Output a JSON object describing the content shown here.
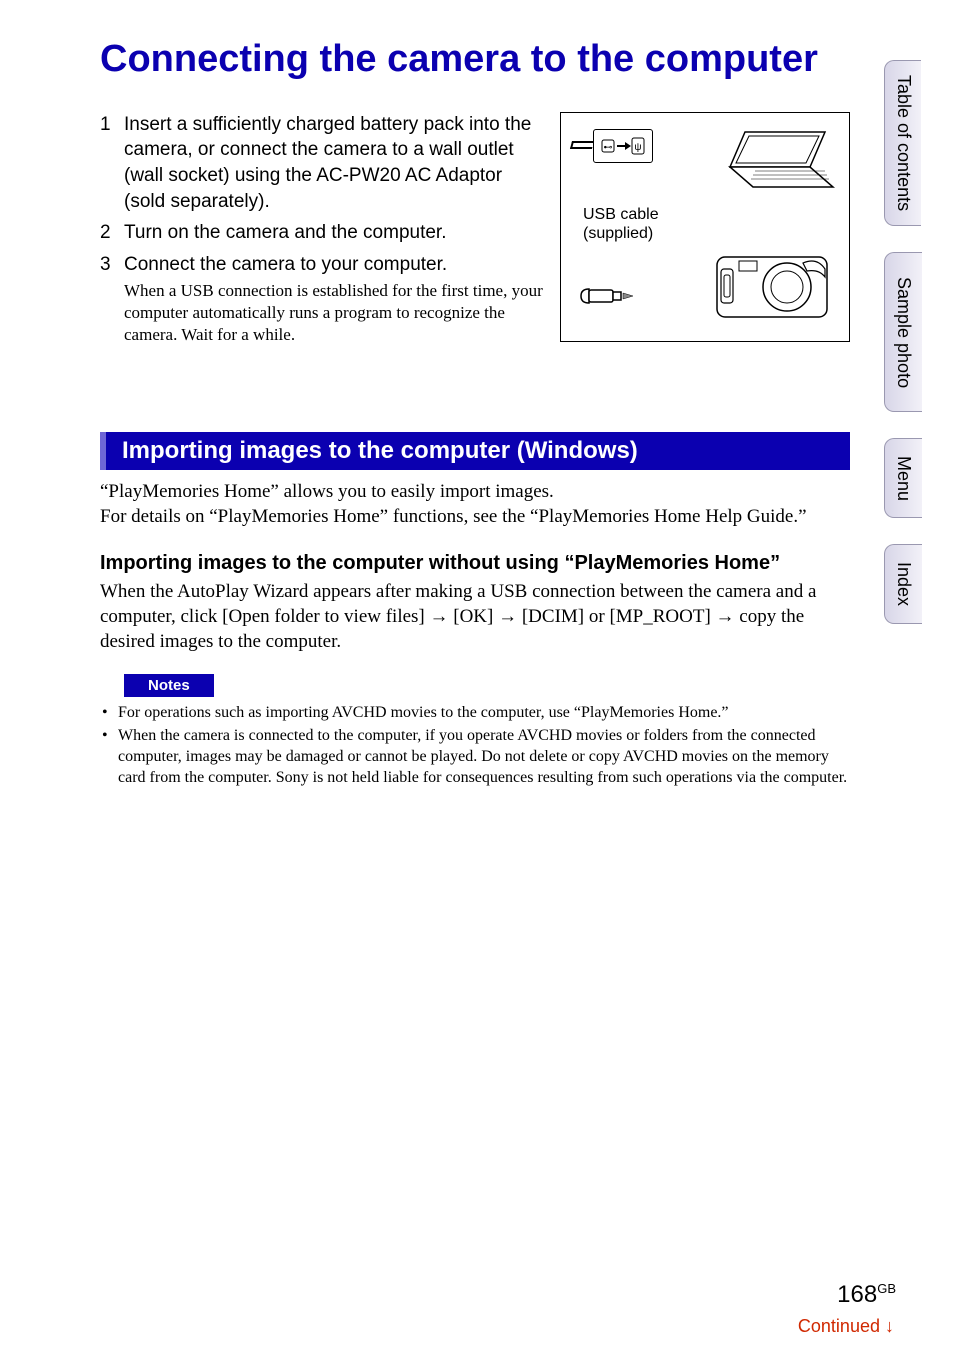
{
  "title": "Connecting the camera to the computer",
  "steps": [
    {
      "text": "Insert a sufficiently charged battery pack into the camera, or connect the camera to a wall outlet (wall socket) using the AC-PW20 AC Adaptor (sold separately).",
      "sub": ""
    },
    {
      "text": "Turn on the camera and the computer.",
      "sub": ""
    },
    {
      "text": "Connect the camera to your computer.",
      "sub": "When a USB connection is established for the first time, your computer automatically runs a program to recognize the camera. Wait for a while."
    }
  ],
  "illustration": {
    "usb_label_line1": "USB cable",
    "usb_label_line2": "(supplied)"
  },
  "section_header": "Importing images to the computer (Windows)",
  "intro_paragraph": "“PlayMemories Home” allows you to easily import images.\nFor details on “PlayMemories Home” functions, see the “PlayMemories Home Help Guide.”",
  "subheading": "Importing images to the computer without using “PlayMemories Home”",
  "subheading_paragraph": "When the AutoPlay Wizard appears after making a USB connection between the camera and a computer, click [Open folder to view files] → [OK] → [DCIM] or [MP_ROOT] → copy the desired images to the computer.",
  "notes_label": "Notes",
  "notes": [
    "For operations such as importing AVCHD movies to the computer, use “PlayMemories Home.”",
    "When the camera is connected to the computer, if you operate AVCHD movies or folders from the connected computer, images may be damaged or cannot be played. Do not delete or copy AVCHD movies on the memory card from the computer. Sony is not held liable for consequences resulting from such operations via the computer."
  ],
  "tabs": {
    "toc": "Table of contents",
    "sample": "Sample photo",
    "menu": "Menu",
    "index": "Index"
  },
  "page_number": "168",
  "page_region": "GB",
  "continued": "Continued",
  "continued_arrow": "↓"
}
